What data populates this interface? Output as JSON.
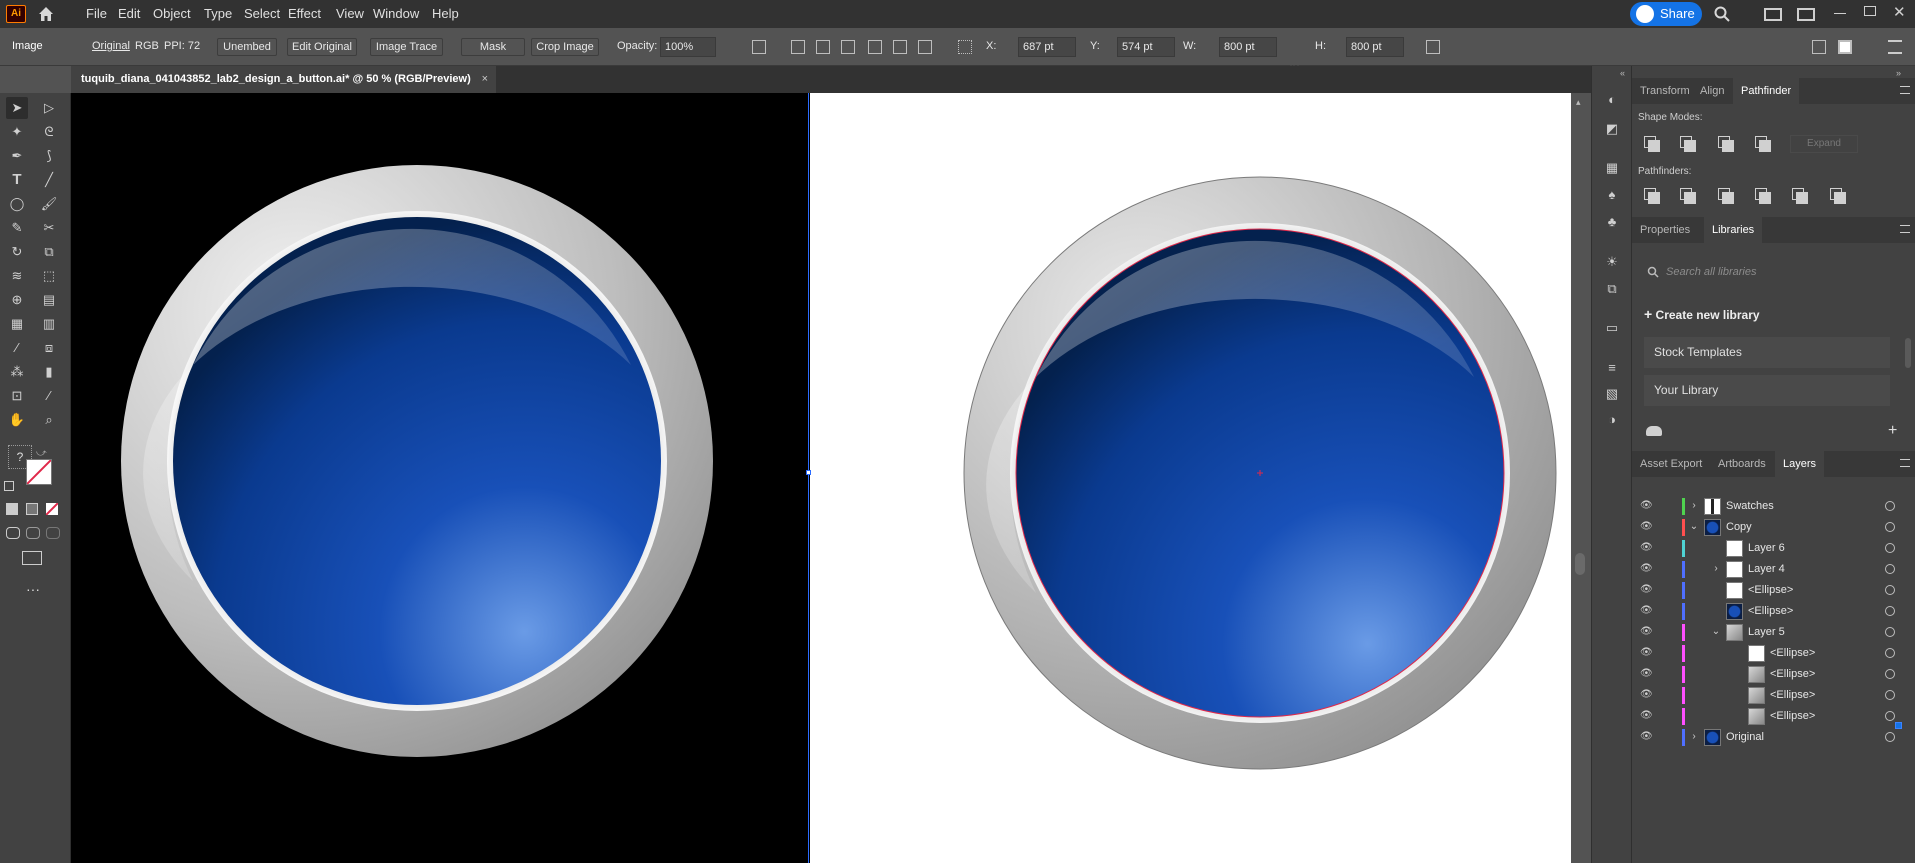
{
  "app": {
    "logo": "Ai"
  },
  "menu": [
    "File",
    "Edit",
    "Object",
    "Type",
    "Select",
    "Effect",
    "View",
    "Window",
    "Help"
  ],
  "share_label": "Share",
  "control": {
    "selection_type": "Image",
    "original": "Original",
    "color_mode": "RGB",
    "ppi": "PPI: 72",
    "unembed": "Unembed",
    "edit_original": "Edit Original",
    "image_trace": "Image Trace",
    "mask": "Mask",
    "crop_image": "Crop Image",
    "opacity_label": "Opacity:",
    "opacity_value": "100%",
    "x_label": "X:",
    "x_value": "687 pt",
    "y_label": "Y:",
    "y_value": "574 pt",
    "w_label": "W:",
    "w_value": "800 pt",
    "h_label": "H:",
    "h_value": "800 pt"
  },
  "document_tab": {
    "title": "tuquib_diana_041043852_lab2_design_a_button.ai* @ 50 % (RGB/Preview)",
    "close": "×"
  },
  "tools": {
    "more": "···",
    "unknown": "?"
  },
  "panels": {
    "top_tabs": [
      "Transform",
      "Align",
      "Pathfinder"
    ],
    "active_top_tab": "Pathfinder",
    "shape_modes_label": "Shape Modes:",
    "expand_label": "Expand",
    "pathfinders_label": "Pathfinders:",
    "lib_tabs": [
      "Properties",
      "Libraries"
    ],
    "active_lib_tab": "Libraries",
    "search_placeholder": "Search all libraries",
    "create_library": "Create new library",
    "libraries": [
      "Stock Templates",
      "Your Library"
    ],
    "bottom_tabs": [
      "Asset Export",
      "Artboards",
      "Layers"
    ],
    "active_bottom_tab": "Layers"
  },
  "layers": [
    {
      "name": "Swatches",
      "indent": 0,
      "toggle": "›",
      "color": "#4fd34f",
      "thumb": "swatch"
    },
    {
      "name": "Copy",
      "indent": 0,
      "toggle": "⌄",
      "color": "#ff4f4f",
      "thumb": "blue"
    },
    {
      "name": "Layer 6",
      "indent": 1,
      "toggle": "",
      "color": "#4fd3d3",
      "thumb": "white"
    },
    {
      "name": "Layer 4",
      "indent": 1,
      "toggle": "›",
      "color": "#4f6fff",
      "thumb": "white"
    },
    {
      "name": "<Ellipse>",
      "indent": 1,
      "toggle": "",
      "color": "#4f6fff",
      "thumb": "white"
    },
    {
      "name": "<Ellipse>",
      "indent": 1,
      "toggle": "",
      "color": "#4f6fff",
      "thumb": "blue"
    },
    {
      "name": "Layer 5",
      "indent": 1,
      "toggle": "⌄",
      "color": "#ff4fff",
      "thumb": "gray"
    },
    {
      "name": "<Ellipse>",
      "indent": 2,
      "toggle": "",
      "color": "#ff4fff",
      "thumb": "white"
    },
    {
      "name": "<Ellipse>",
      "indent": 2,
      "toggle": "",
      "color": "#ff4fff",
      "thumb": "gray"
    },
    {
      "name": "<Ellipse>",
      "indent": 2,
      "toggle": "",
      "color": "#ff4fff",
      "thumb": "gray"
    },
    {
      "name": "<Ellipse>",
      "indent": 2,
      "toggle": "",
      "color": "#ff4fff",
      "thumb": "gray"
    },
    {
      "name": "Original",
      "indent": 0,
      "toggle": "›",
      "color": "#4f6fff",
      "thumb": "blue"
    }
  ],
  "colors": {
    "accent": "#1473e6",
    "button_blue": "#0a46b0",
    "selection_red": "#e0284a"
  }
}
